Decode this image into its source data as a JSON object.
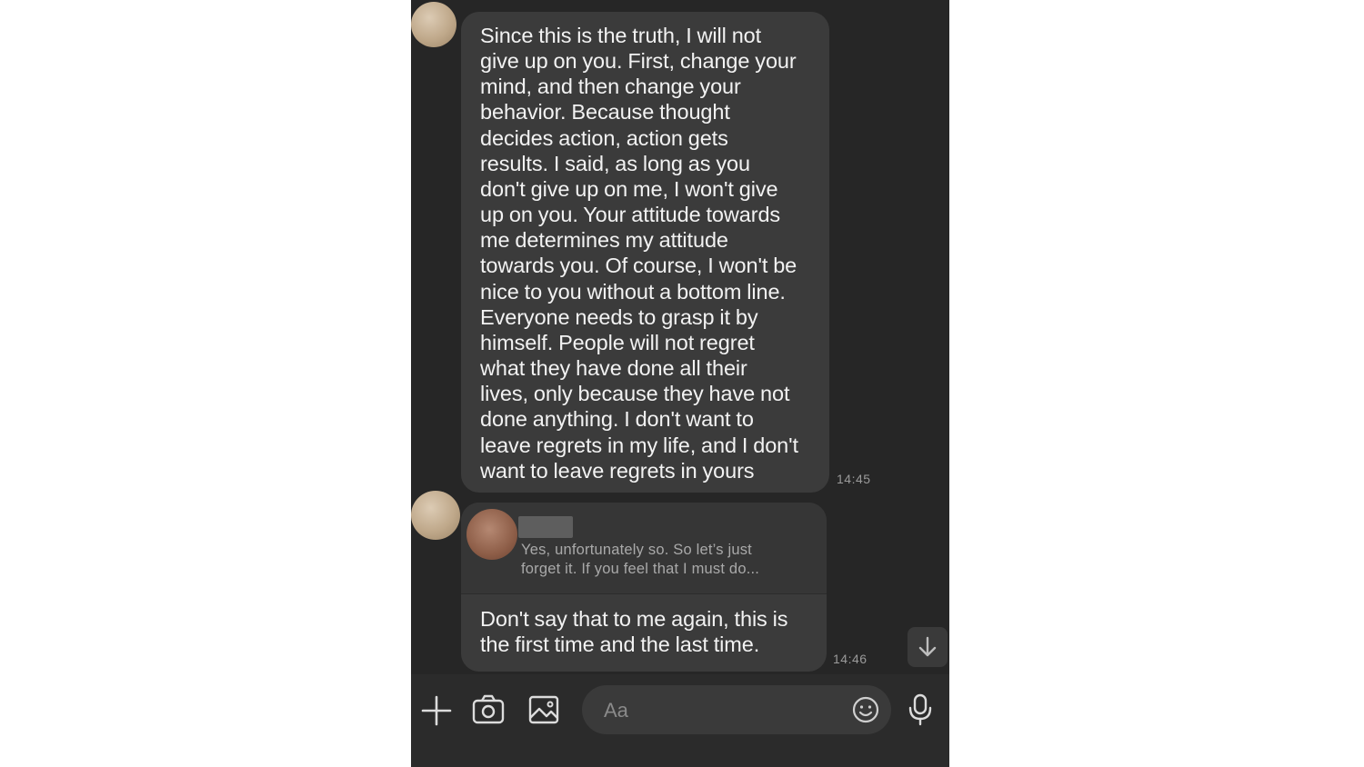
{
  "messages": [
    {
      "text": "Since this is the truth, I will not\ngive up on you. First, change your\nmind, and then change your\nbehavior. Because thought\ndecides action, action gets\nresults. I said, as long as you\ndon't give up on me, I won't give\nup on you. Your attitude towards\nme determines my attitude\ntowards you. Of course, I won't be\nnice to you without a bottom line.\nEveryone needs to grasp it by\nhimself. People will not regret\nwhat they have done all their\nlives, only because they have not\ndone anything. I don't want to\nleave regrets in my life, and I don't\nwant to leave regrets in yours",
      "time": "14:45"
    },
    {
      "quote": "Yes, unfortunately so. So let’s just\nforget it. If you feel that I must do...",
      "text": "Don't say that to me again, this is\nthe first time and the last time.",
      "time": "14:46"
    }
  ],
  "composer": {
    "placeholder": "Aa",
    "icons": [
      "plus-icon",
      "camera-icon",
      "image-icon",
      "emoji-icon",
      "microphone-icon"
    ]
  },
  "scroll_button_icon": "arrow-down-icon",
  "colors": {
    "background": "#262626",
    "bubble": "#3b3b3b",
    "text": "#f2f2f2",
    "timestamp": "#9a9a9a"
  }
}
